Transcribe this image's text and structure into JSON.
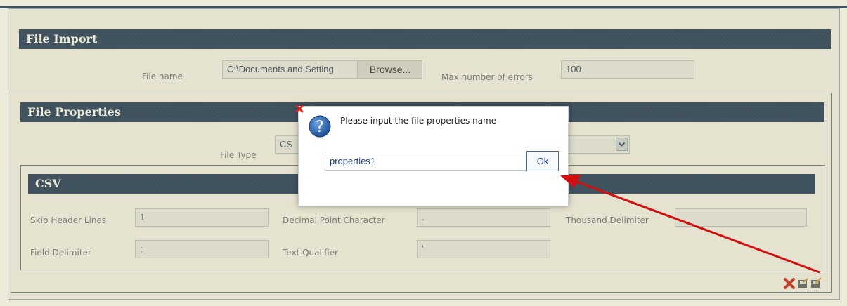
{
  "file_import": {
    "title": "File Import",
    "file_name_label": "File name",
    "file_name_value": "C:\\Documents and Setting",
    "browse_label": "Browse...",
    "max_errors_label": "Max number of errors",
    "max_errors_value": "100"
  },
  "file_properties": {
    "title": "File Properties",
    "file_type_label": "File Type",
    "file_type_value": "CS"
  },
  "csv": {
    "title": "CSV",
    "skip_header_label": "Skip Header Lines",
    "skip_header_value": "1",
    "decimal_point_label": "Decimal Point Character",
    "decimal_point_value": ".",
    "thousand_delim_label": "Thousand Delimiter",
    "thousand_delim_value": "",
    "field_delim_label": "Field Delimiter",
    "field_delim_value": ";",
    "text_qualifier_label": "Text Qualifier",
    "text_qualifier_value": "'"
  },
  "dialog": {
    "message": "Please input the file properties name",
    "input_value": "properties1",
    "ok_label": "Ok"
  },
  "colors": {
    "header_bg": "#0d2a55",
    "arrow": "#d40e0e",
    "close_red": "#d9261c"
  },
  "icons": [
    "close-icon",
    "question-icon",
    "dropdown-arrow-icon",
    "delete-icon",
    "save-icon",
    "save-as-icon"
  ]
}
